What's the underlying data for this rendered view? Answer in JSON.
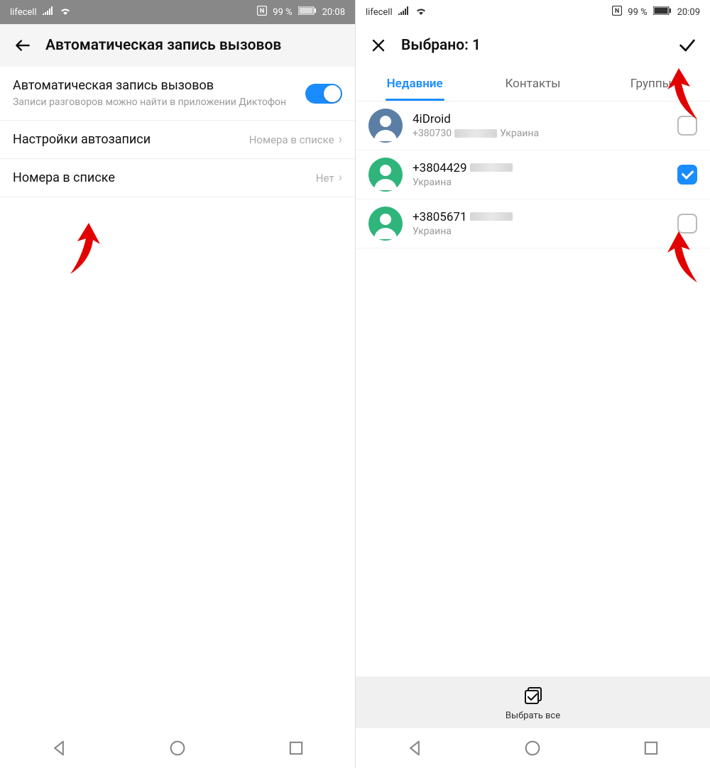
{
  "left": {
    "status": {
      "carrier": "lifecell",
      "battery": "99 %",
      "time": "20:08"
    },
    "header": {
      "title": "Автоматическая запись вызовов"
    },
    "rows": {
      "rec": {
        "title": "Автоматическая запись вызовов",
        "sub": "Записи разговоров можно найти в приложении Диктофон"
      },
      "settings": {
        "title": "Настройки автозаписи",
        "value": "Номера в списке"
      },
      "list": {
        "title": "Номера в списке",
        "value": "Нет"
      }
    }
  },
  "right": {
    "status": {
      "carrier": "lifecell",
      "battery": "99 %",
      "time": "20:09"
    },
    "header": {
      "title": "Выбрано: 1"
    },
    "tabs": {
      "recent": "Недавние",
      "contacts": "Контакты",
      "groups": "Группы"
    },
    "contacts": [
      {
        "name": "4iDroid",
        "numPrefix": "+380730",
        "region": "Украина",
        "checked": false,
        "color": "#5b7ea5"
      },
      {
        "name": "+3804429",
        "numPrefix": "",
        "region": "Украина",
        "checked": true,
        "color": "#2fb57b"
      },
      {
        "name": "+3805671",
        "numPrefix": "",
        "region": "Украина",
        "checked": false,
        "color": "#2fb57b"
      }
    ],
    "selectAll": "Выбрать все"
  }
}
